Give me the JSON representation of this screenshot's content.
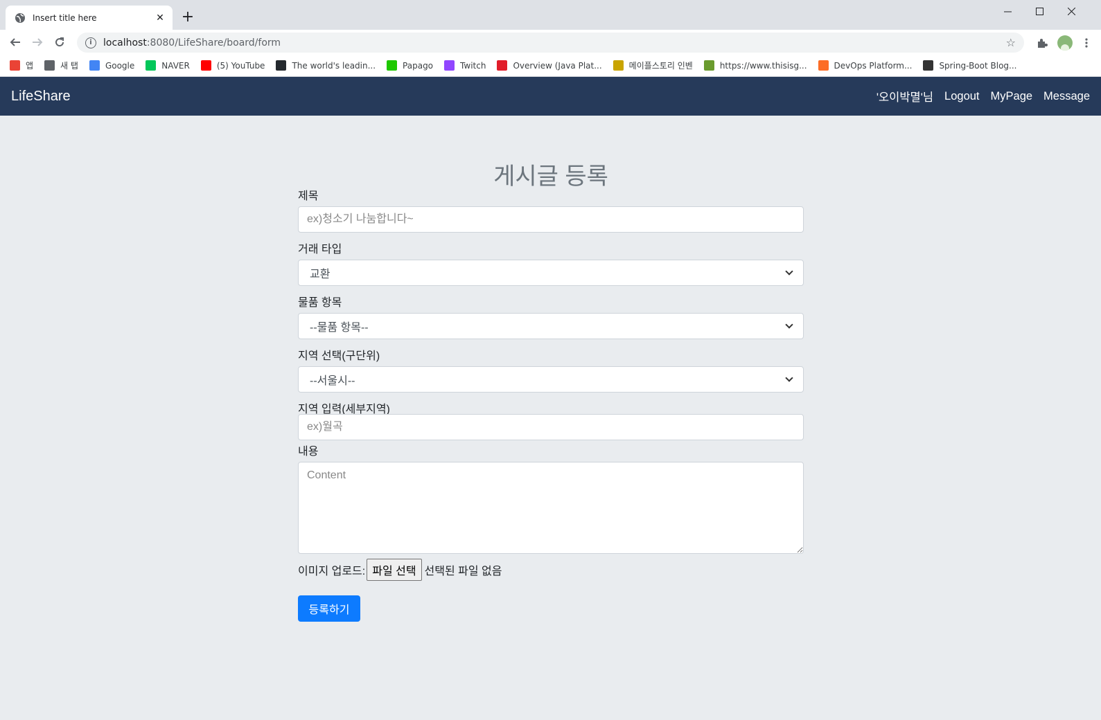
{
  "browser": {
    "tab_title": "Insert title here",
    "tab_close": "✕",
    "new_tab": "+",
    "url_host": "localhost",
    "url_rest": ":8080/LifeShare/board/form",
    "bookmarks": [
      {
        "label": "앱",
        "icon": "apps-grid-icon",
        "color": "#ea4335"
      },
      {
        "label": "새 탭",
        "icon": "globe-icon",
        "color": "#5f6368"
      },
      {
        "label": "Google",
        "icon": "google-icon",
        "color": "#4285f4"
      },
      {
        "label": "NAVER",
        "icon": "naver-icon",
        "color": "#03c75a"
      },
      {
        "label": "(5) YouTube",
        "icon": "youtube-icon",
        "color": "#ff0000"
      },
      {
        "label": "The world's leadin...",
        "icon": "github-icon",
        "color": "#24292e"
      },
      {
        "label": "Papago",
        "icon": "papago-icon",
        "color": "#1ec800"
      },
      {
        "label": "Twitch",
        "icon": "twitch-icon",
        "color": "#9146ff"
      },
      {
        "label": "Overview (Java Plat...",
        "icon": "java-icon",
        "color": "#e11d2a"
      },
      {
        "label": "메이플스토리 인벤",
        "icon": "inven-icon",
        "color": "#c9a400"
      },
      {
        "label": "https://www.thisisg...",
        "icon": "puzzle-icon",
        "color": "#6a9b2e"
      },
      {
        "label": "DevOps Platform...",
        "icon": "gitlab-icon",
        "color": "#fc6d26"
      },
      {
        "label": "Spring-Boot Blog...",
        "icon": "dots-icon",
        "color": "#333333"
      }
    ]
  },
  "navbar": {
    "brand": "LifeShare",
    "user": "'오이박멸'님",
    "logout": "Logout",
    "mypage": "MyPage",
    "message": "Message",
    "bg_color": "#263a5a"
  },
  "form": {
    "page_title": "게시글 등록",
    "title_label": "제목",
    "title_placeholder": "ex)청소기 나눔합니다~",
    "deal_type_label": "거래 타입",
    "deal_type_value": "교환",
    "category_label": "물품 항목",
    "category_value": "--물품 항목--",
    "region_label": "지역 선택(구단위)",
    "region_value": "--서울시--",
    "region_detail_label": "지역 입력(세부지역)",
    "region_detail_placeholder": "ex)월곡",
    "content_label": "내용",
    "content_placeholder": "Content",
    "upload_label": "이미지 업로드:",
    "file_button": "파일 선택",
    "file_status": "선택된 파일 없음",
    "submit_label": "등록하기",
    "submit_color": "#0d7bff"
  }
}
